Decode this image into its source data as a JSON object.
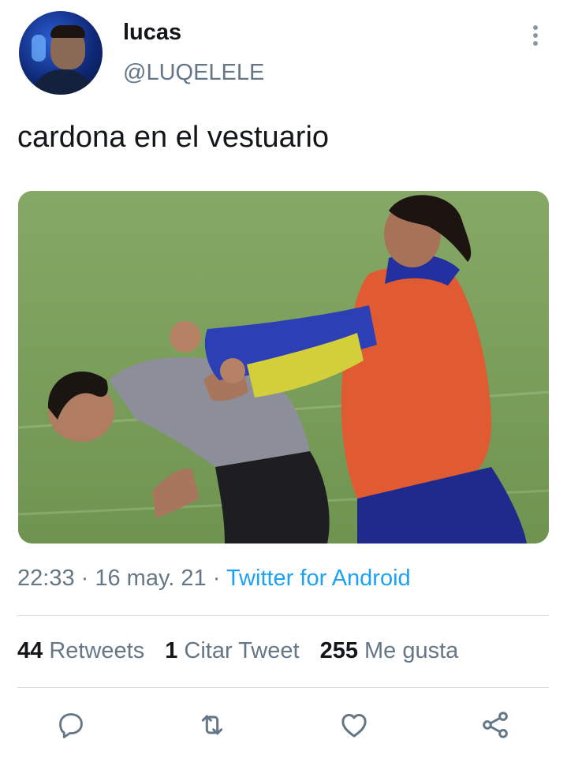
{
  "author": {
    "display_name": "lucas",
    "handle": "@LUQELELE",
    "avatar_icon": "user-avatar"
  },
  "tweet": {
    "text": "cardona en el vestuario",
    "media_icon": "photo-two-soccer-players-on-field"
  },
  "meta": {
    "time": "22:33",
    "separator": " · ",
    "date": "16 may. 21",
    "source": "Twitter for Android"
  },
  "stats": {
    "retweets": {
      "count": "44",
      "label": "Retweets"
    },
    "quotes": {
      "count": "1",
      "label": "Citar Tweet"
    },
    "likes": {
      "count": "255",
      "label": "Me gusta"
    }
  },
  "actions": {
    "reply_icon": "reply-icon",
    "retweet_icon": "retweet-icon",
    "like_icon": "heart-icon",
    "share_icon": "share-icon"
  },
  "colors": {
    "text": "#14171a",
    "secondary": "#657786",
    "accent": "#1da1f2",
    "divider": "#d6dde2"
  }
}
